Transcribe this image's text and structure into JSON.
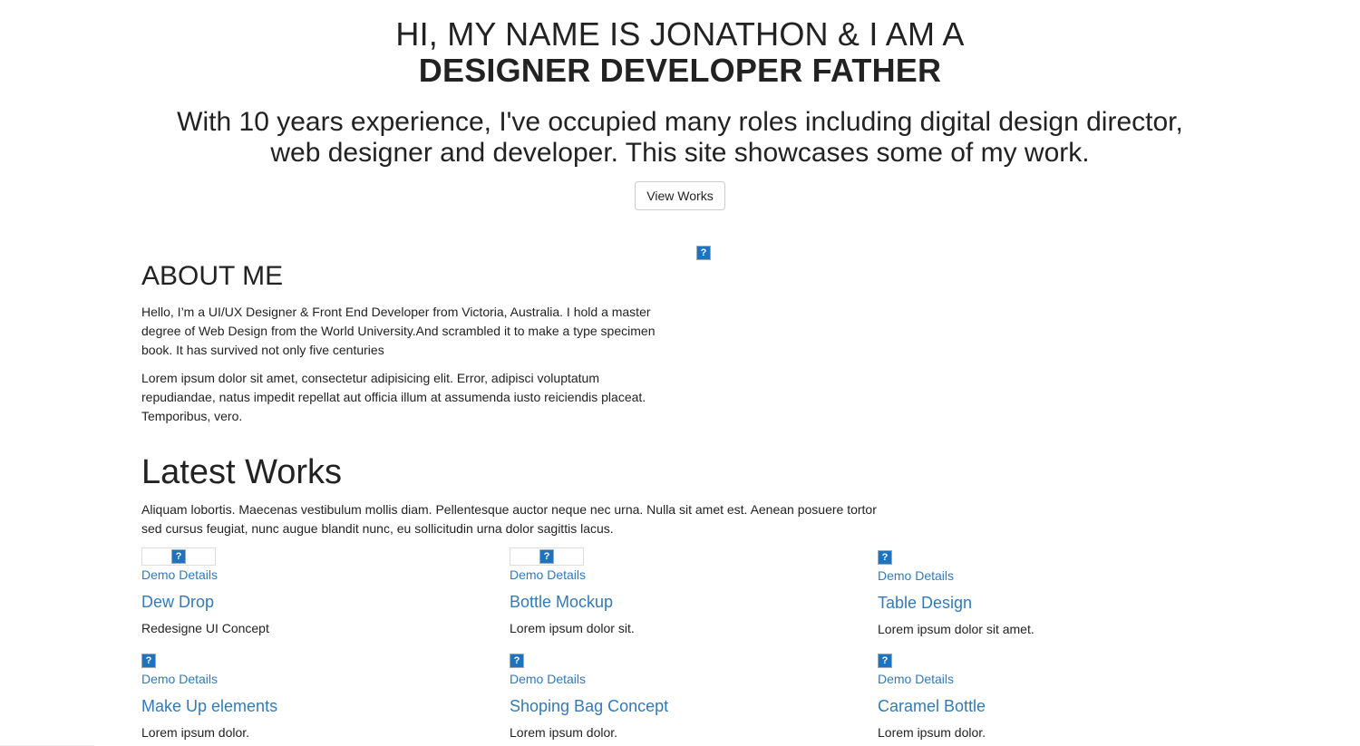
{
  "hero": {
    "title_line1": "HI, MY NAME IS JONATHON & I AM A",
    "title_line2": "DESIGNER DEVELOPER FATHER",
    "subtitle_line1": "With 10 years experience, I've occupied many roles including digital design director,",
    "subtitle_line2": "web designer and developer. This site showcases some of my work.",
    "button_label": "View Works"
  },
  "about": {
    "heading": "ABOUT ME",
    "para1": "Hello, I’m a UI/UX Designer & Front End Developer from Victoria, Australia. I hold a master degree of Web Design from the World University.And scrambled it to make a type specimen book. It has survived not only five centuries",
    "para2": "Lorem ipsum dolor sit amet, consectetur adipisicing elit. Error, adipisci voluptatum repudiandae, natus impedit repellat aut officia illum at assumenda iusto reiciendis placeat. Temporibus, vero."
  },
  "works": {
    "heading": "Latest Works",
    "lead": "Aliquam lobortis. Maecenas vestibulum mollis diam. Pellentesque auctor neque nec urna. Nulla sit amet est. Aenean posuere tortor sed cursus feugiat, nunc augue blandit nunc, eu sollicitudin urna dolor sagittis lacus.",
    "items": [
      {
        "link": "Demo Details",
        "title": "Dew Drop",
        "desc": "Redesigne UI Concept"
      },
      {
        "link": "Demo Details",
        "title": "Bottle Mockup",
        "desc": "Lorem ipsum dolor sit."
      },
      {
        "link": "Demo Details",
        "title": "Table Design",
        "desc": "Lorem ipsum dolor sit amet."
      },
      {
        "link": "Demo Details",
        "title": "Make Up elements",
        "desc": "Lorem ipsum dolor."
      },
      {
        "link": "Demo Details",
        "title": "Shoping Bag Concept",
        "desc": "Lorem ipsum dolor."
      },
      {
        "link": "Demo Details",
        "title": "Caramel Bottle",
        "desc": "Lorem ipsum dolor."
      }
    ]
  },
  "icons": {
    "broken_image": "broken-image-icon",
    "glyph": "?"
  },
  "colors": {
    "link": "#337ab7",
    "text": "#222222",
    "broken_image": "#1e73be"
  }
}
